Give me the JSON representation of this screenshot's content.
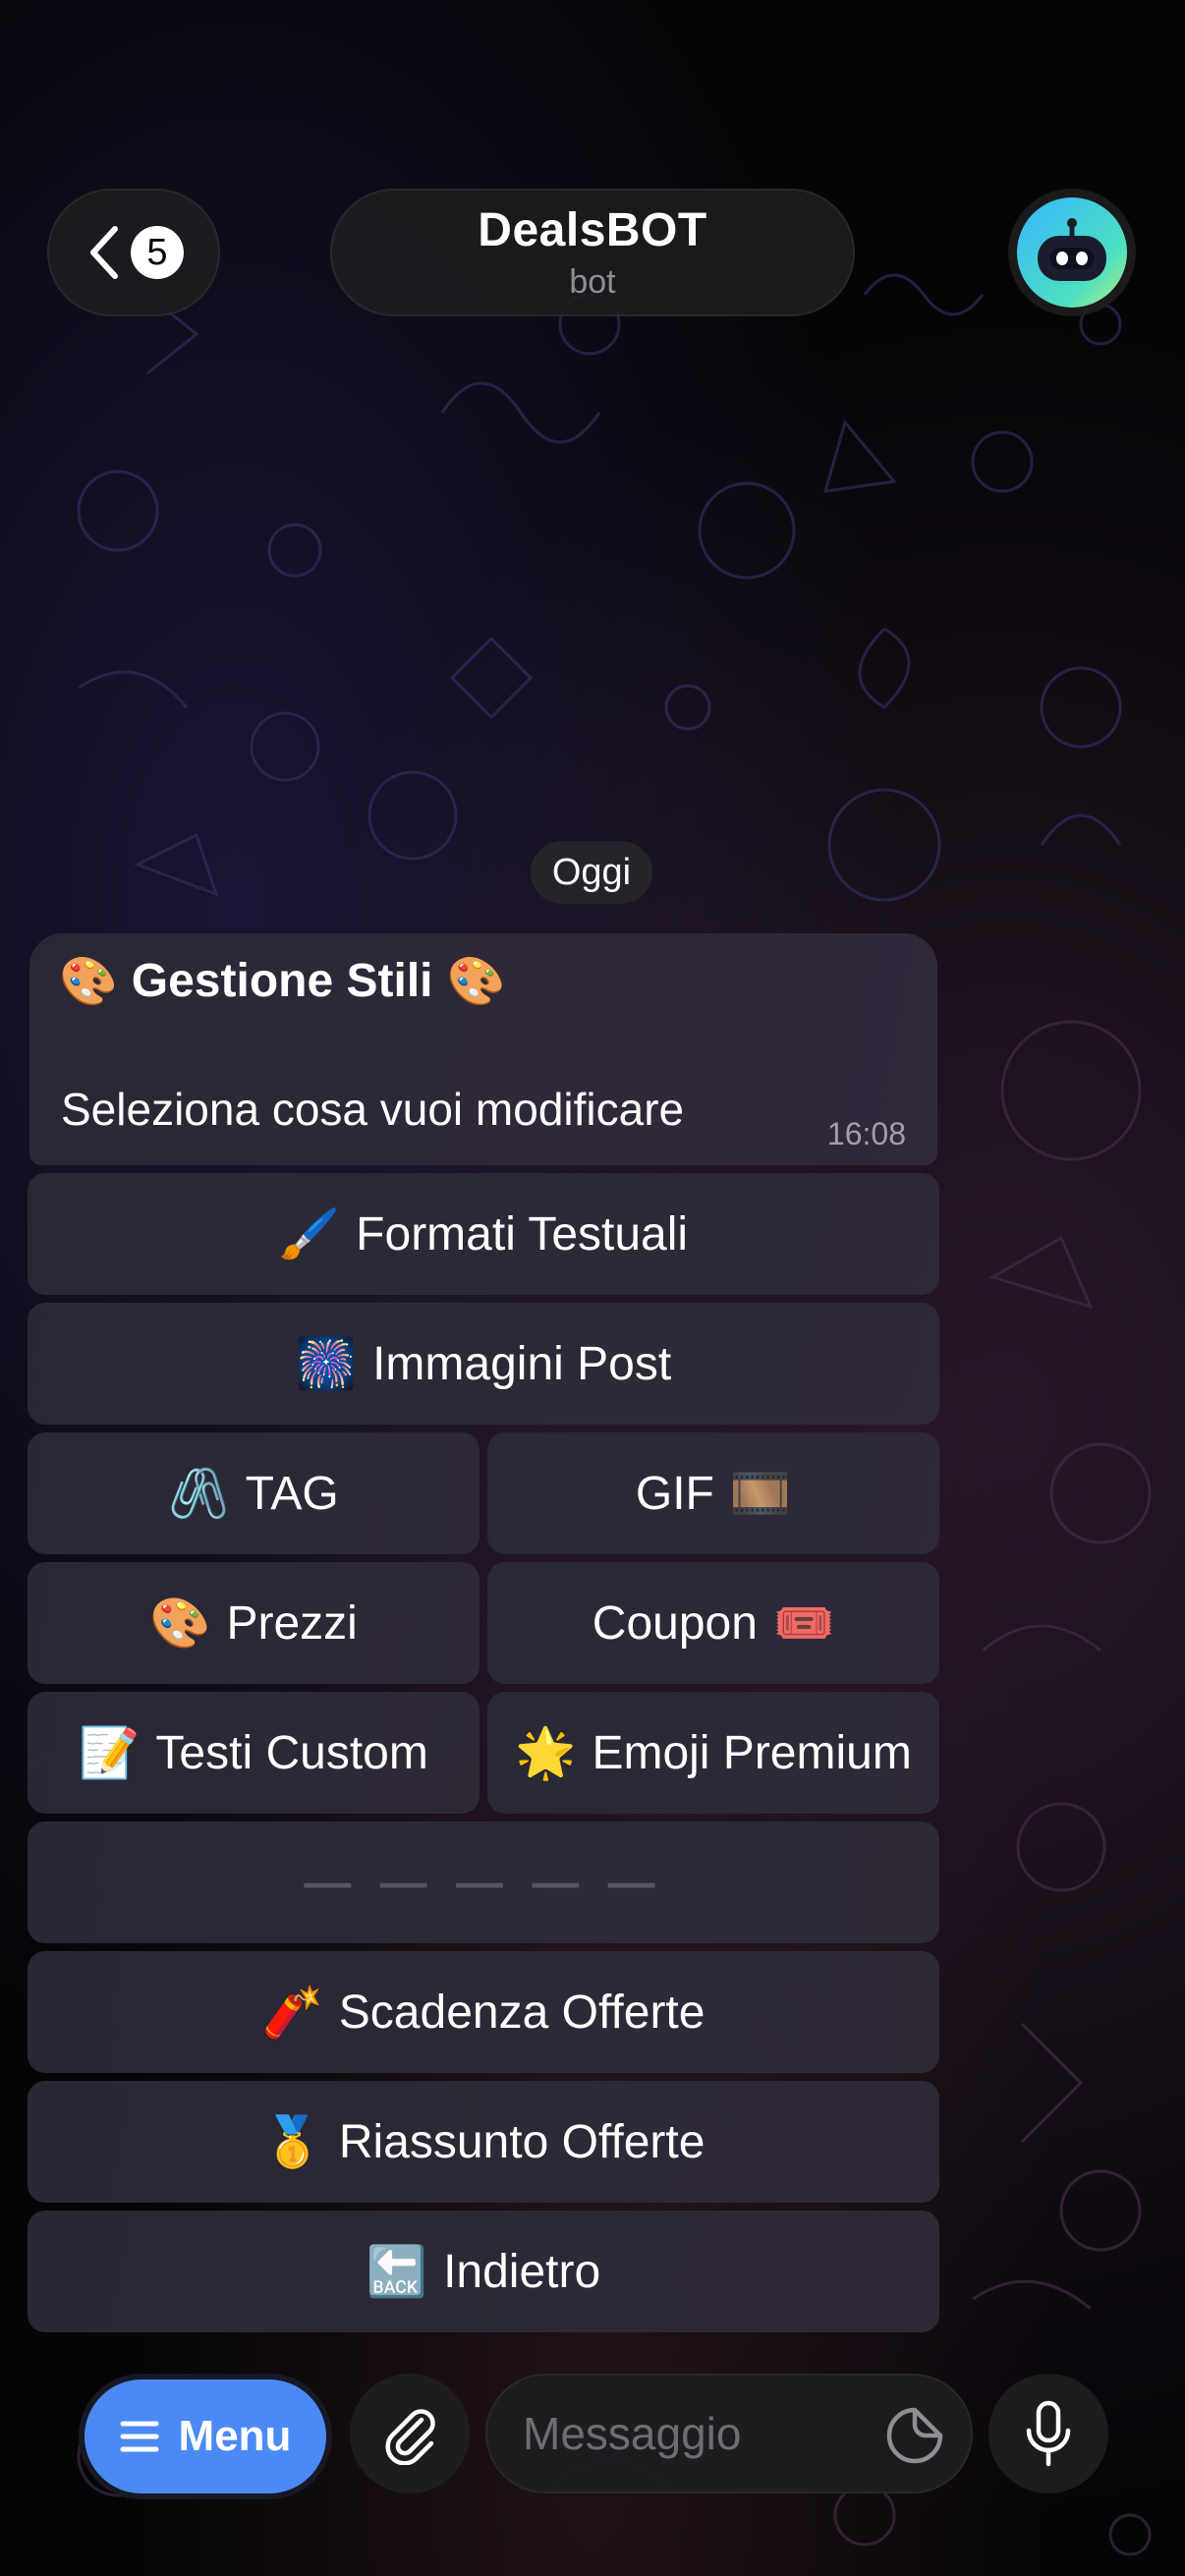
{
  "header": {
    "unread_count": "5",
    "chat_name": "DealsBOT",
    "chat_subtitle": "bot"
  },
  "date_chip": "Oggi",
  "message": {
    "heading_emoji_left": "🎨",
    "heading": "Gestione Stili",
    "heading_emoji_right": "🎨",
    "body": "Seleziona cosa vuoi modificare",
    "time": "16:08"
  },
  "keyboard": {
    "formati": {
      "emoji": "🖌️",
      "label": "Formati Testuali"
    },
    "immagini": {
      "emoji": "🎆",
      "label": "Immagini Post"
    },
    "tag": {
      "emoji": "🖇️",
      "label": "TAG"
    },
    "gif": {
      "emoji": "🎞️",
      "label": "GIF"
    },
    "prezzi": {
      "emoji": "🎨",
      "label": "Prezzi"
    },
    "coupon": {
      "emoji": "🎟️",
      "label": "Coupon"
    },
    "testi": {
      "emoji": "📝",
      "label": "Testi Custom"
    },
    "emoji_premium": {
      "emoji": "🌟",
      "label": "Emoji Premium"
    },
    "divider": {
      "label": "— — — — —"
    },
    "scadenza": {
      "emoji": "🧨",
      "label": "Scadenza Offerte"
    },
    "riassunto": {
      "emoji": "🥇",
      "label": "Riassunto Offerte"
    },
    "indietro": {
      "emoji": "🔙",
      "label": "Indietro"
    }
  },
  "bottom_bar": {
    "menu_label": "Menu",
    "input_placeholder": "Messaggio"
  },
  "colors": {
    "menu_button": "#4b8af5",
    "bubble": "#2a2835",
    "background": "#050507"
  }
}
